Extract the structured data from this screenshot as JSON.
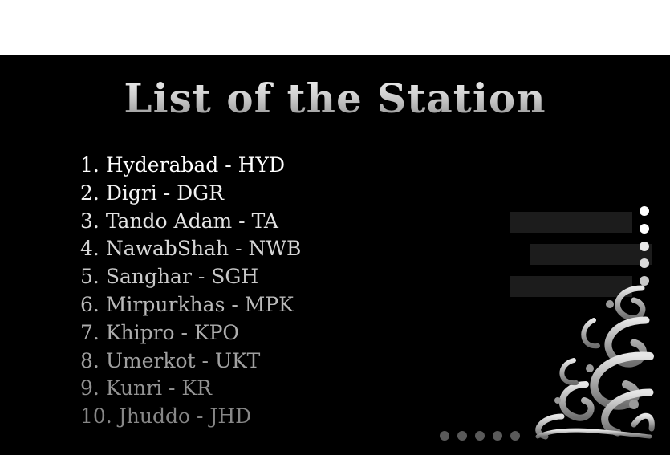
{
  "slide": {
    "title": "List of the Station",
    "stations": [
      {
        "num": "1.",
        "text": "Hyderabad - HYD",
        "color": "#ffffff"
      },
      {
        "num": "2.",
        "text": "Digri - DGR",
        "color": "#f2f2f2"
      },
      {
        "num": "3.",
        "text": "Tando Adam - TA",
        "color": "#e4e4e4"
      },
      {
        "num": "4.",
        "text": "NawabShah - NWB",
        "color": "#d6d6d6"
      },
      {
        "num": "5.",
        "text": "Sanghar - SGH",
        "color": "#c8c8c8"
      },
      {
        "num": "6.",
        "text": "Mirpurkhas - MPK",
        "color": "#bababa"
      },
      {
        "num": "7.",
        "text": "Khipro - KPO",
        "color": "#adadad"
      },
      {
        "num": "8.",
        "text": "Umerkot - UKT",
        "color": "#a0a0a0"
      },
      {
        "num": "9.",
        "text": "Kunri - KR",
        "color": "#939393"
      },
      {
        "num": "10.",
        "text": "Jhuddo - JHD",
        "color": "#878787"
      }
    ]
  }
}
